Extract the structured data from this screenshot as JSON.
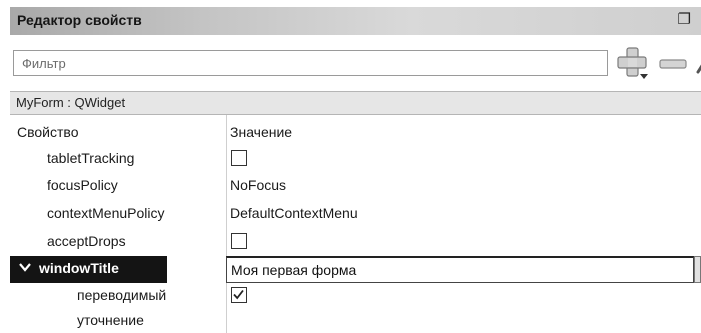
{
  "panel": {
    "title": "Редактор свойств",
    "float_icon": "float-window-icon"
  },
  "filter": {
    "placeholder": "Фильтр",
    "value": "",
    "add_icon": "plus-dropdown-icon",
    "remove_icon": "minus-icon",
    "configure_icon": "wrench-icon"
  },
  "object": {
    "label": "MyForm : QWidget"
  },
  "columns": {
    "property": "Свойство",
    "value": "Значение"
  },
  "rows": [
    {
      "name": "tabletTracking",
      "value_type": "checkbox",
      "checked": false
    },
    {
      "name": "focusPolicy",
      "value": "NoFocus"
    },
    {
      "name": "contextMenuPolicy",
      "value": "DefaultContextMenu"
    },
    {
      "name": "acceptDrops",
      "value_type": "checkbox",
      "checked": false
    },
    {
      "name": "windowTitle",
      "value": "Моя первая форма",
      "expanded": true,
      "editing": true
    },
    {
      "name": "переводимый",
      "value_type": "checkbox",
      "checked": true,
      "sub": true
    },
    {
      "name": "уточнение",
      "value": "",
      "sub": true
    }
  ],
  "colors": {
    "title_gradient_start": "#a9a9a9",
    "selected_row": "#141414",
    "object_bar": "#e6e6e6"
  }
}
